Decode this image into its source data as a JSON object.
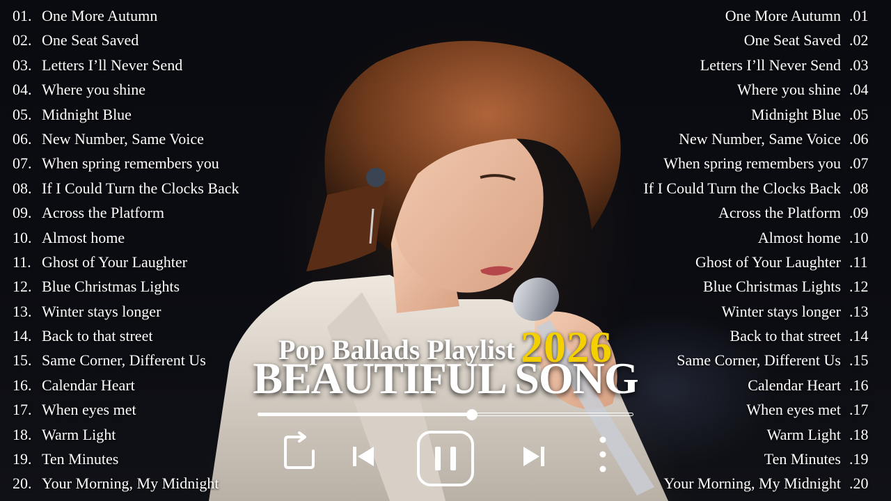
{
  "playlist_left": [
    {
      "num": "01.",
      "title": "One More Autumn"
    },
    {
      "num": "02.",
      "title": "One Seat Saved"
    },
    {
      "num": "03.",
      "title": "Letters I’ll Never Send"
    },
    {
      "num": "04.",
      "title": "Where you shine"
    },
    {
      "num": "05.",
      "title": "Midnight Blue"
    },
    {
      "num": "06.",
      "title": "New Number, Same Voice"
    },
    {
      "num": "07.",
      "title": "When spring remembers you"
    },
    {
      "num": "08.",
      "title": "If I Could Turn the Clocks Back"
    },
    {
      "num": "09.",
      "title": "Across the Platform"
    },
    {
      "num": "10.",
      "title": "Almost home"
    },
    {
      "num": "11.",
      "title": "Ghost of Your Laughter"
    },
    {
      "num": "12.",
      "title": "Blue Christmas Lights"
    },
    {
      "num": "13.",
      "title": "Winter stays longer"
    },
    {
      "num": "14.",
      "title": "Back to that street"
    },
    {
      "num": "15.",
      "title": "Same Corner, Different Us"
    },
    {
      "num": "16.",
      "title": "Calendar Heart"
    },
    {
      "num": "17.",
      "title": "When eyes met"
    },
    {
      "num": "18.",
      "title": "Warm Light"
    },
    {
      "num": "19.",
      "title": "Ten Minutes"
    },
    {
      "num": "20.",
      "title": "Your Morning, My Midnight"
    }
  ],
  "playlist_right": [
    {
      "num": ".01",
      "title": "One More Autumn"
    },
    {
      "num": ".02",
      "title": "One Seat Saved"
    },
    {
      "num": ".03",
      "title": "Letters I’ll Never Send"
    },
    {
      "num": ".04",
      "title": "Where you shine"
    },
    {
      "num": ".05",
      "title": "Midnight Blue"
    },
    {
      "num": ".06",
      "title": "New Number, Same Voice"
    },
    {
      "num": ".07",
      "title": "When spring remembers you"
    },
    {
      "num": ".08",
      "title": "If I Could Turn the Clocks Back"
    },
    {
      "num": ".09",
      "title": "Across the Platform"
    },
    {
      "num": ".10",
      "title": "Almost home"
    },
    {
      "num": ".11",
      "title": "Ghost of Your Laughter"
    },
    {
      "num": ".12",
      "title": "Blue Christmas Lights"
    },
    {
      "num": ".13",
      "title": "Winter stays longer"
    },
    {
      "num": ".14",
      "title": "Back to that street"
    },
    {
      "num": ".15",
      "title": "Same Corner, Different Us"
    },
    {
      "num": ".16",
      "title": "Calendar Heart"
    },
    {
      "num": ".17",
      "title": "When eyes met"
    },
    {
      "num": ".18",
      "title": "Warm Light"
    },
    {
      "num": ".19",
      "title": "Ten Minutes"
    },
    {
      "num": ".20",
      "title": "Your Morning, My Midnight"
    }
  ],
  "banner": {
    "subtitle": "Pop Ballads Playlist",
    "year": "2026",
    "title": "BEAUTIFUL SONG",
    "year_color": "#f4d000"
  },
  "player": {
    "progress": 0.57,
    "icons": [
      "repeat-icon",
      "previous-icon",
      "pause-icon",
      "next-icon",
      "more-icon"
    ]
  }
}
